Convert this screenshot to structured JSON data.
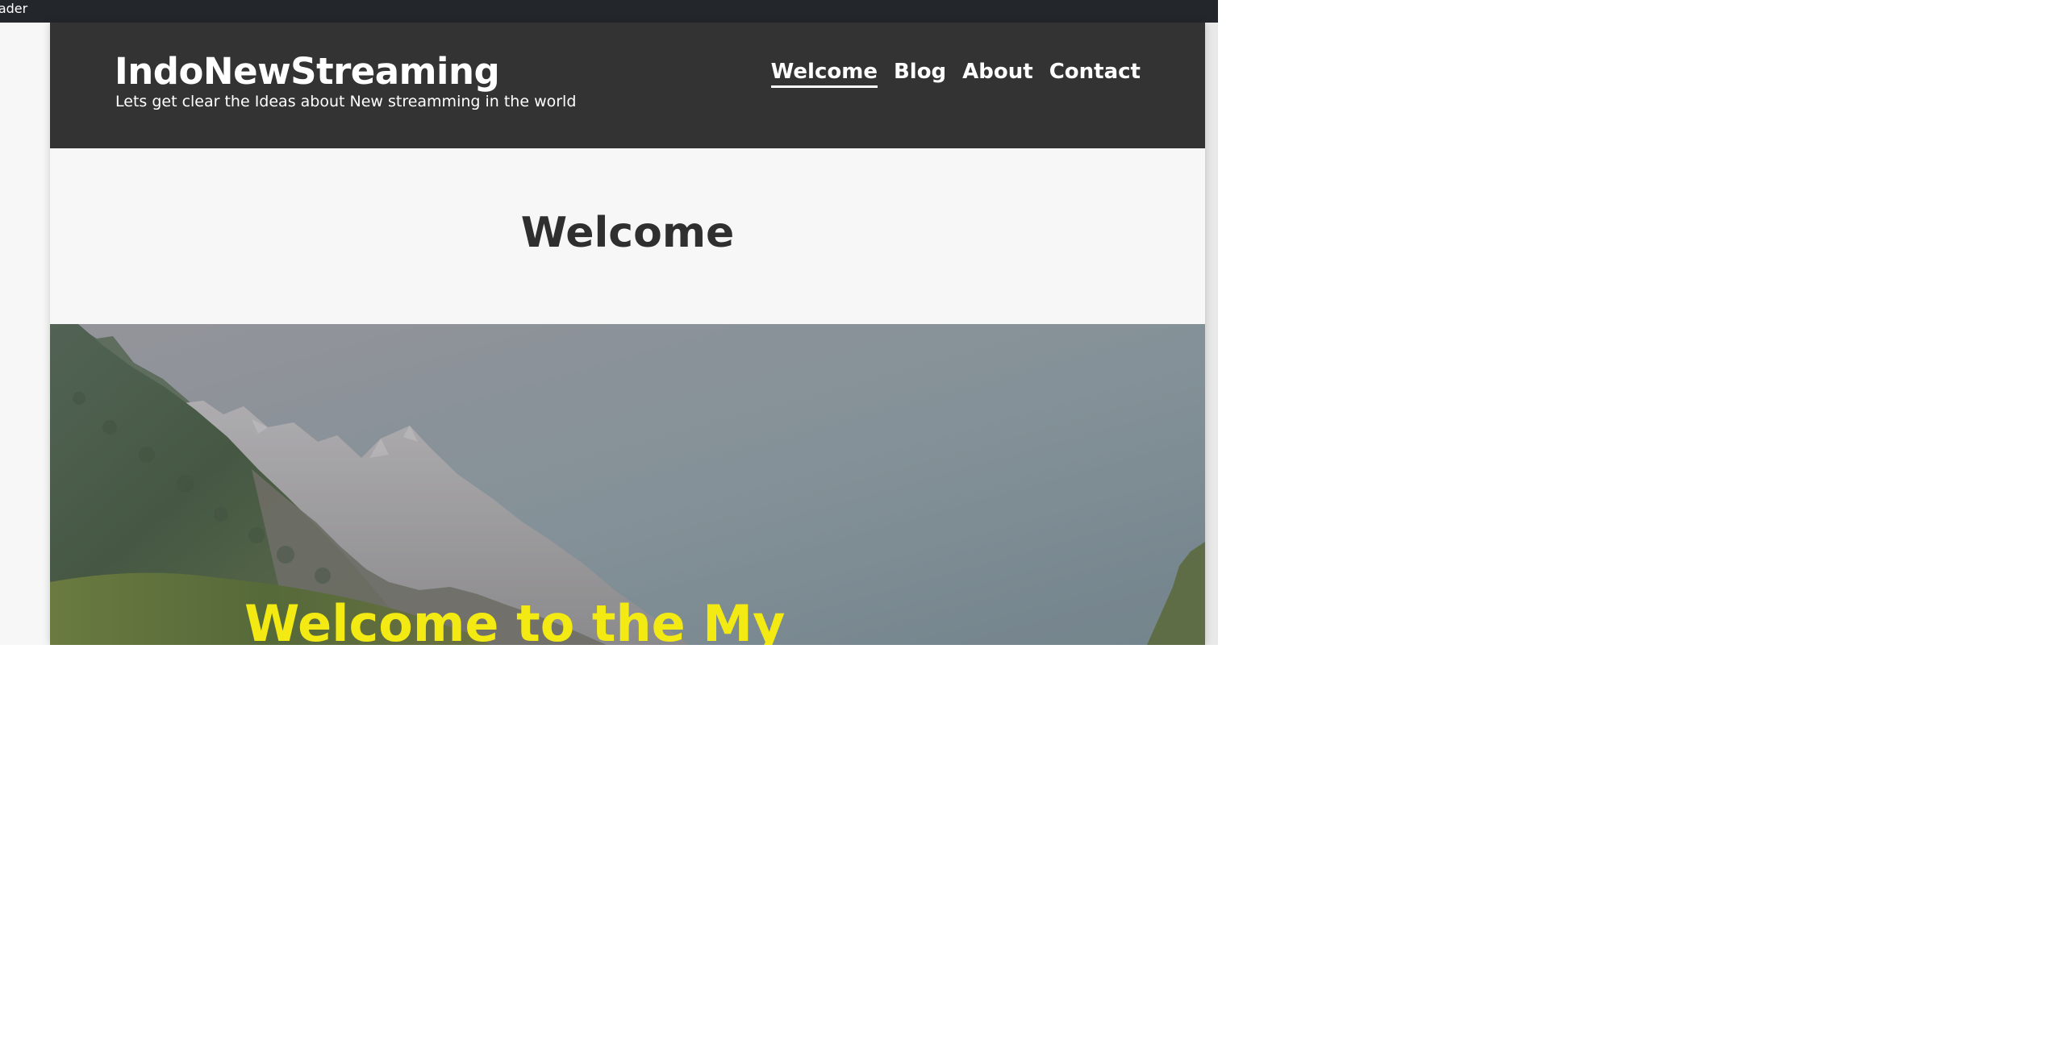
{
  "topbar": {
    "text": "eader"
  },
  "header": {
    "site_title": "IndoNewStreaming",
    "tagline": "Lets get clear the Ideas about New streamming in the world",
    "nav": [
      {
        "label": "Welcome",
        "active": true
      },
      {
        "label": "Blog",
        "active": false
      },
      {
        "label": "About",
        "active": false
      },
      {
        "label": "Contact",
        "active": false
      }
    ]
  },
  "page": {
    "title": "Welcome"
  },
  "hero": {
    "heading": "Welcome to the My",
    "heading_color": "#f2ea12"
  },
  "colors": {
    "header_bg": "#333333",
    "title_band_bg": "#f7f7f7",
    "topbar_bg": "#23272b"
  }
}
